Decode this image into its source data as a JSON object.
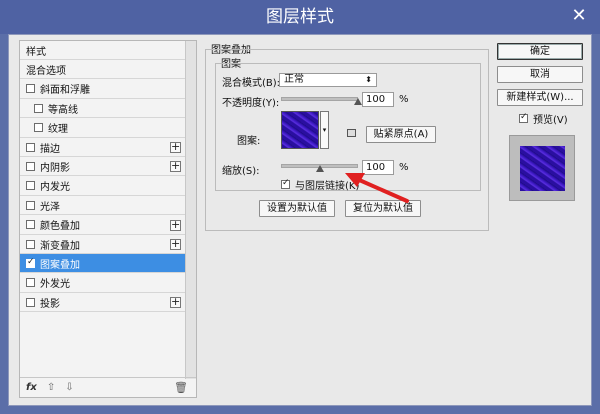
{
  "window": {
    "title": "图层样式",
    "close_symbol": "✕"
  },
  "left_panel": {
    "items": [
      {
        "label": "样式",
        "checkbox": false,
        "checked": false,
        "plus": false,
        "indent": false,
        "selected": false
      },
      {
        "label": "混合选项",
        "checkbox": false,
        "checked": false,
        "plus": false,
        "indent": false,
        "selected": false
      },
      {
        "label": "斜面和浮雕",
        "checkbox": true,
        "checked": false,
        "plus": false,
        "indent": false,
        "selected": false
      },
      {
        "label": "等高线",
        "checkbox": true,
        "checked": false,
        "plus": false,
        "indent": true,
        "selected": false
      },
      {
        "label": "纹理",
        "checkbox": true,
        "checked": false,
        "plus": false,
        "indent": true,
        "selected": false
      },
      {
        "label": "描边",
        "checkbox": true,
        "checked": false,
        "plus": true,
        "indent": false,
        "selected": false
      },
      {
        "label": "内阴影",
        "checkbox": true,
        "checked": false,
        "plus": true,
        "indent": false,
        "selected": false
      },
      {
        "label": "内发光",
        "checkbox": true,
        "checked": false,
        "plus": false,
        "indent": false,
        "selected": false
      },
      {
        "label": "光泽",
        "checkbox": true,
        "checked": false,
        "plus": false,
        "indent": false,
        "selected": false
      },
      {
        "label": "颜色叠加",
        "checkbox": true,
        "checked": false,
        "plus": true,
        "indent": false,
        "selected": false
      },
      {
        "label": "渐变叠加",
        "checkbox": true,
        "checked": false,
        "plus": true,
        "indent": false,
        "selected": false
      },
      {
        "label": "图案叠加",
        "checkbox": true,
        "checked": true,
        "plus": false,
        "indent": false,
        "selected": true
      },
      {
        "label": "外发光",
        "checkbox": true,
        "checked": false,
        "plus": false,
        "indent": false,
        "selected": false
      },
      {
        "label": "投影",
        "checkbox": true,
        "checked": false,
        "plus": true,
        "indent": false,
        "selected": false
      }
    ],
    "footer": {
      "fx_label": "fx",
      "up_symbol": "⇧",
      "down_symbol": "⇩",
      "trash_symbol": "🗑"
    }
  },
  "pattern_overlay": {
    "group_title": "图案叠加",
    "subgroup_title": "图案",
    "blend_mode_label": "混合模式(B):",
    "blend_mode_value": "正常",
    "opacity_label": "不透明度(Y):",
    "opacity_value": "100",
    "opacity_unit": "%",
    "opacity_level": 1.0,
    "pattern_label": "图案:",
    "snap_origin_button": "贴紧原点(A)",
    "scale_label": "缩放(S):",
    "scale_value": "100",
    "scale_unit": "%",
    "scale_level": 0.5,
    "link_layer_label": "与图层链接(K)",
    "link_layer_checked": true,
    "set_default_button": "设置为默认值",
    "reset_default_button": "复位为默认值"
  },
  "right_panel": {
    "ok_button": "确定",
    "cancel_button": "取消",
    "new_style_button": "新建样式(W)...",
    "preview_label": "预览(V)",
    "preview_checked": true
  },
  "colors": {
    "accent_selected": "#3d8ee3",
    "pattern_primary": "#2a0fa0",
    "arrow": "#e02020"
  }
}
